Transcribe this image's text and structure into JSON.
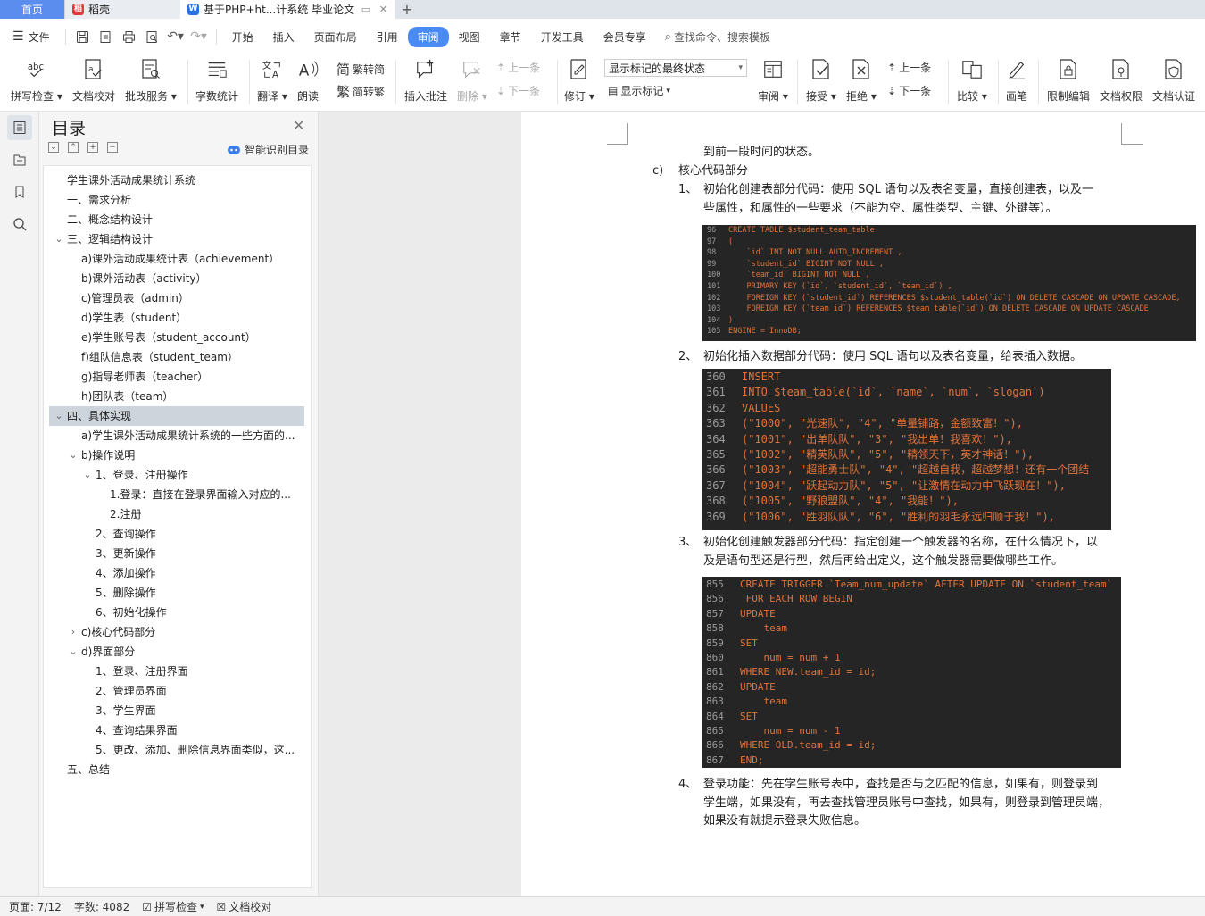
{
  "tabs": {
    "home": "首页",
    "daoke": "稻壳",
    "doc": "基于PHP+ht...计系统 毕业论文"
  },
  "menu": {
    "file": "文件",
    "items": [
      "开始",
      "插入",
      "页面布局",
      "引用",
      "审阅",
      "视图",
      "章节",
      "开发工具",
      "会员专享"
    ],
    "active": "审阅",
    "search": "查找命令、搜索模板"
  },
  "ribbon": {
    "spell": "拼写检查",
    "proof": "文档校对",
    "annotate_service": "批改服务",
    "wordcount": "字数统计",
    "translate": "翻译",
    "read": "朗读",
    "trad": "繁转简",
    "simp": "简转繁",
    "insert_comment": "插入批注",
    "delete": "删除",
    "prev": "上一条",
    "next": "下一条",
    "revise": "修订",
    "markup_state": "显示标记的最终状态",
    "show_markup": "显示标记",
    "review": "审阅",
    "accept": "接受",
    "reject": "拒绝",
    "prev2": "上一条",
    "next2": "下一条",
    "compare": "比较",
    "pen": "画笔",
    "restrict": "限制编辑",
    "rights": "文档权限",
    "cert": "文档认证"
  },
  "toc": {
    "title": "目录",
    "smart": "智能识别目录",
    "items": [
      {
        "text": "学生课外活动成果统计系统",
        "level": 0,
        "arrow": ""
      },
      {
        "text": "一、需求分析",
        "level": 0,
        "arrow": ""
      },
      {
        "text": "二、概念结构设计",
        "level": 0,
        "arrow": ""
      },
      {
        "text": "三、逻辑结构设计",
        "level": 0,
        "arrow": "down"
      },
      {
        "text": "a)课外活动成果统计表（achievement）",
        "level": 1,
        "arrow": ""
      },
      {
        "text": "b)课外活动表（activity）",
        "level": 1,
        "arrow": ""
      },
      {
        "text": "c)管理员表（admin）",
        "level": 1,
        "arrow": ""
      },
      {
        "text": "d)学生表（student）",
        "level": 1,
        "arrow": ""
      },
      {
        "text": "e)学生账号表（student_account）",
        "level": 1,
        "arrow": ""
      },
      {
        "text": "f)组队信息表（student_team）",
        "level": 1,
        "arrow": ""
      },
      {
        "text": "g)指导老师表（teacher）",
        "level": 1,
        "arrow": ""
      },
      {
        "text": "h)团队表（team）",
        "level": 1,
        "arrow": ""
      },
      {
        "text": "四、具体实现",
        "level": 0,
        "arrow": "down",
        "selected": true
      },
      {
        "text": "a)学生课外活动成果统计系统的一些方面的...",
        "level": 1,
        "arrow": ""
      },
      {
        "text": "b)操作说明",
        "level": 1,
        "arrow": "down"
      },
      {
        "text": "1、登录、注册操作",
        "level": 2,
        "arrow": "down"
      },
      {
        "text": "1.登录：直接在登录界面输入对应的...",
        "level": 3,
        "arrow": ""
      },
      {
        "text": "2.注册",
        "level": 3,
        "arrow": ""
      },
      {
        "text": "2、查询操作",
        "level": 2,
        "arrow": ""
      },
      {
        "text": "3、更新操作",
        "level": 2,
        "arrow": ""
      },
      {
        "text": "4、添加操作",
        "level": 2,
        "arrow": ""
      },
      {
        "text": "5、删除操作",
        "level": 2,
        "arrow": ""
      },
      {
        "text": "6、初始化操作",
        "level": 2,
        "arrow": ""
      },
      {
        "text": "c)核心代码部分",
        "level": 1,
        "arrow": "right"
      },
      {
        "text": "d)界面部分",
        "level": 1,
        "arrow": "down"
      },
      {
        "text": "1、登录、注册界面",
        "level": 2,
        "arrow": ""
      },
      {
        "text": "2、管理员界面",
        "level": 2,
        "arrow": ""
      },
      {
        "text": "3、学生界面",
        "level": 2,
        "arrow": ""
      },
      {
        "text": "4、查询结果界面",
        "level": 2,
        "arrow": ""
      },
      {
        "text": "5、更改、添加、删除信息界面类似，这...",
        "level": 2,
        "arrow": ""
      },
      {
        "text": "五、总结",
        "level": 0,
        "arrow": ""
      }
    ]
  },
  "doc": {
    "line_prev": "到前一段时间的状态。",
    "c_marker": "c)",
    "c_title": "核心代码部分",
    "p1_num": "1、",
    "p1_l1": "初始化创建表部分代码：使用 SQL 语句以及表名变量，直接创建表，以及一",
    "p1_l2": "些属性，和属性的一些要求（不能为空、属性类型、主键、外键等）。",
    "code1": [
      [
        "96",
        "CREATE TABLE $student_team_table"
      ],
      [
        "97",
        "("
      ],
      [
        "98",
        "    `id` INT NOT NULL AUTO_INCREMENT ,"
      ],
      [
        "99",
        "    `student_id` BIGINT NOT NULL ,"
      ],
      [
        "100",
        "    `team_id` BIGINT NOT NULL ,"
      ],
      [
        "101",
        "    PRIMARY KEY (`id`, `student_id`, `team_id`) ,"
      ],
      [
        "102",
        "    FOREIGN KEY (`student_id`) REFERENCES $student_table(`id`) ON DELETE CASCADE ON UPDATE CASCADE,"
      ],
      [
        "103",
        "    FOREIGN KEY (`team_id`) REFERENCES $team_table(`id`) ON DELETE CASCADE ON UPDATE CASCADE"
      ],
      [
        "104",
        ")"
      ],
      [
        "105",
        "ENGINE = InnoDB;"
      ]
    ],
    "p2_num": "2、",
    "p2_l1": "初始化插入数据部分代码：使用 SQL 语句以及表名变量，给表插入数据。",
    "code2": [
      [
        "360",
        "INSERT"
      ],
      [
        "361",
        "INTO $team_table(`id`, `name`, `num`, `slogan`)"
      ],
      [
        "362",
        "VALUES"
      ],
      [
        "363",
        "(\"1000\", \"光速队\", \"4\", \"单量铺路，金额致富！\"),"
      ],
      [
        "364",
        "(\"1001\", \"出单队队\", \"3\", \"我出单！我喜欢！\"),"
      ],
      [
        "365",
        "(\"1002\", \"精英队队\", \"5\", \"精领天下，英才神话！\"),"
      ],
      [
        "366",
        "(\"1003\", \"超能勇士队\", \"4\", \"超越自我，超越梦想！还有一个团结"
      ],
      [
        "367",
        "(\"1004\", \"跃起动力队\", \"5\", \"让激情在动力中飞跃现在！\"),"
      ],
      [
        "368",
        "(\"1005\", \"野狼盟队\", \"4\", \"我能！\"),"
      ],
      [
        "369",
        "(\"1006\", \"胜羽队队\", \"6\", \"胜利的羽毛永远归顺于我！\"),"
      ]
    ],
    "p3_num": "3、",
    "p3_l1": "初始化创建触发器部分代码：指定创建一个触发器的名称，在什么情况下，以",
    "p3_l2": "及是语句型还是行型，然后再给出定义，这个触发器需要做哪些工作。",
    "code3": [
      [
        "855",
        "CREATE TRIGGER `Team_num_update` AFTER UPDATE ON `student_team`"
      ],
      [
        "856",
        " FOR EACH ROW BEGIN"
      ],
      [
        "857",
        "UPDATE"
      ],
      [
        "858",
        "    team"
      ],
      [
        "859",
        "SET"
      ],
      [
        "860",
        "    num = num + 1"
      ],
      [
        "861",
        "WHERE NEW.team_id = id;"
      ],
      [
        "862",
        "UPDATE"
      ],
      [
        "863",
        "    team"
      ],
      [
        "864",
        "SET"
      ],
      [
        "865",
        "    num = num - 1"
      ],
      [
        "866",
        "WHERE OLD.team_id = id;"
      ],
      [
        "867",
        "END;"
      ]
    ],
    "p4_num": "4、",
    "p4_l1": "登录功能：先在学生账号表中，查找是否与之匹配的信息，如果有，则登录到",
    "p4_l2": "学生端，如果没有，再去查找管理员账号中查找，如果有，则登录到管理员端，",
    "p4_l3": "如果没有就提示登录失败信息。"
  },
  "status": {
    "page": "页面: 7/12",
    "words": "字数: 4082",
    "spell": "拼写检查",
    "proof": "文档校对"
  },
  "colors": {
    "accent": "#4a8af4",
    "code_bg": "#252525",
    "code_fg": "#e0733a",
    "toc_selected": "#cdd4dc"
  }
}
